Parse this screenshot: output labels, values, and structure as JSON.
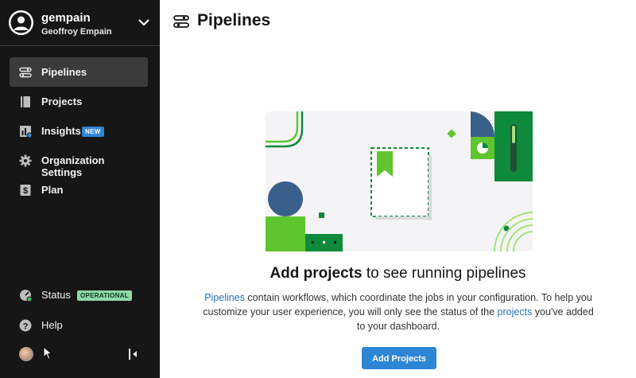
{
  "org": {
    "name": "gempain",
    "user_full_name": "Geoffroy Empain"
  },
  "nav": {
    "pipelines": "Pipelines",
    "projects": "Projects",
    "insights": "Insights",
    "insights_badge": "NEW",
    "org_settings": "Organization Settings",
    "plan": "Plan"
  },
  "footer": {
    "status": "Status",
    "status_badge": "OPERATIONAL",
    "help": "Help"
  },
  "page": {
    "title": "Pipelines"
  },
  "empty_state": {
    "headline_bold": "Add projects",
    "headline_rest": " to see running pipelines",
    "desc_link1": "Pipelines",
    "desc_part1": " contain workflows, which coordinate the jobs in your configuration. To help you customize your user experience, you will only see the status of the ",
    "desc_link2": "projects",
    "desc_part2": " you've added to your dashboard.",
    "button": "Add Projects"
  },
  "colors": {
    "sidebar_bg": "#161616",
    "active_item_bg": "#3b3b3b",
    "accent_blue": "#2d86d4",
    "brand_green": "#0e8a3c",
    "lime_green": "#5fc52e",
    "navy": "#3a5f8a",
    "operational_badge": "#8fd8a8"
  }
}
